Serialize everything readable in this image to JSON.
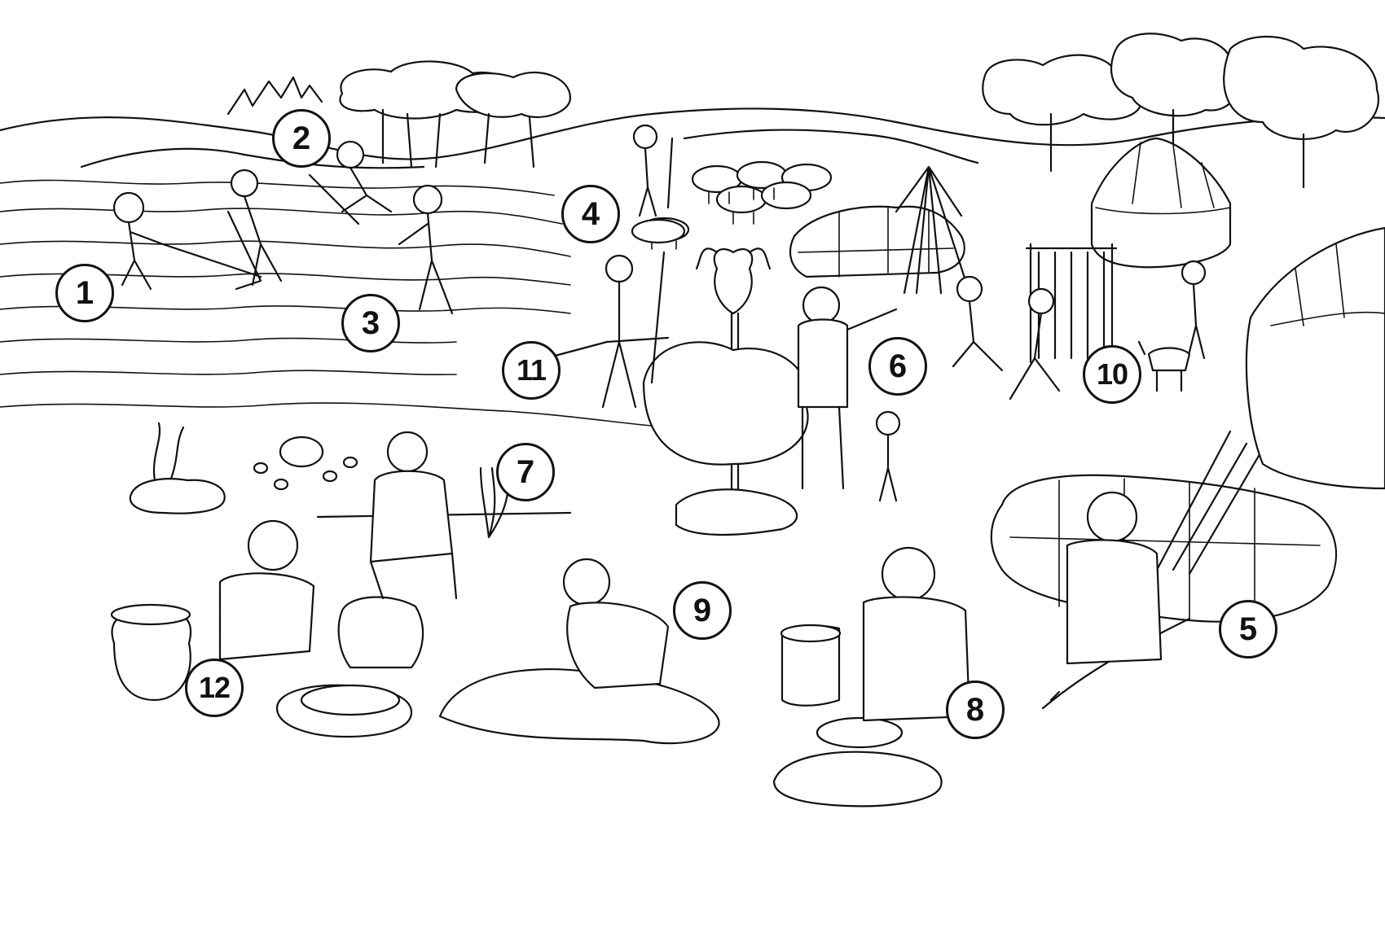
{
  "scene": {
    "line_color": "#111111",
    "background_color": "#ffffff"
  },
  "markers": [
    {
      "id": "1",
      "label": "1",
      "activity": "farmer-pulling-plough"
    },
    {
      "id": "2",
      "label": "2",
      "activity": "farmer-digging"
    },
    {
      "id": "3",
      "label": "3",
      "activity": "farmer-sowing-seeds"
    },
    {
      "id": "4",
      "label": "4",
      "activity": "shepherd-with-flock"
    },
    {
      "id": "5",
      "label": "5",
      "activity": "man-crafting-spears"
    },
    {
      "id": "6",
      "label": "6",
      "activity": "chief-at-totem"
    },
    {
      "id": "7",
      "label": "7",
      "activity": "man-with-pitchfork"
    },
    {
      "id": "8",
      "label": "8",
      "activity": "potter-at-wheel"
    },
    {
      "id": "9",
      "label": "9",
      "activity": "woman-stretching-hide"
    },
    {
      "id": "10",
      "label": "10",
      "activity": "women-weaving-loom"
    },
    {
      "id": "11",
      "label": "11",
      "activity": "hunter-with-bow"
    },
    {
      "id": "12",
      "label": "12",
      "activity": "woman-grinding-grain"
    }
  ]
}
